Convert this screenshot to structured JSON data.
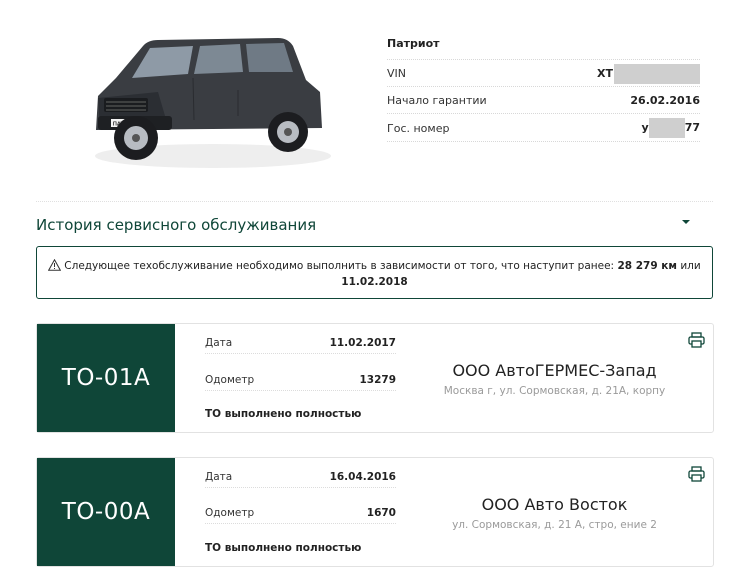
{
  "vehicle": {
    "model": "Патриот",
    "vin_label": "VIN",
    "vin_value": "ХТ",
    "warranty_label": "Начало гарантии",
    "warranty_value": "26.02.2016",
    "plate_label": "Гос. номер",
    "plate_prefix": "у",
    "plate_suffix": "77",
    "car_badge": "ПАТРИОТ"
  },
  "history": {
    "title": "История сервисного обслуживания",
    "notice_text": "Следующее техобслуживание необходимо выполнить в зависимости от того, что наступит ранее:",
    "notice_km": "28 279 км",
    "notice_or": "или",
    "notice_date": "11.02.2018"
  },
  "services": [
    {
      "code": "ТО-01А",
      "date_label": "Дата",
      "date": "11.02.2017",
      "odometer_label": "Одометр",
      "odometer": "13279",
      "status": "ТО выполнено полностью",
      "dealer": "ООО АвтоГЕРМЕС-Запад",
      "address": "Москва г, ул. Сормовская, д. 21А, корпу"
    },
    {
      "code": "ТО-00А",
      "date_label": "Дата",
      "date": "16.04.2016",
      "odometer_label": "Одометр",
      "odometer": "1670",
      "status": "ТО выполнено полностью",
      "dealer": "ООО Авто Восток",
      "address": "ул. Сормовская, д. 21 А, стро, ение 2"
    }
  ],
  "colors": {
    "brand_green": "#0f4638",
    "muted_text": "#9a9a9a",
    "mask_gray": "#cfcfcf"
  },
  "icons": [
    "car-image",
    "chevron-down-icon",
    "warning-icon",
    "print-icon"
  ]
}
